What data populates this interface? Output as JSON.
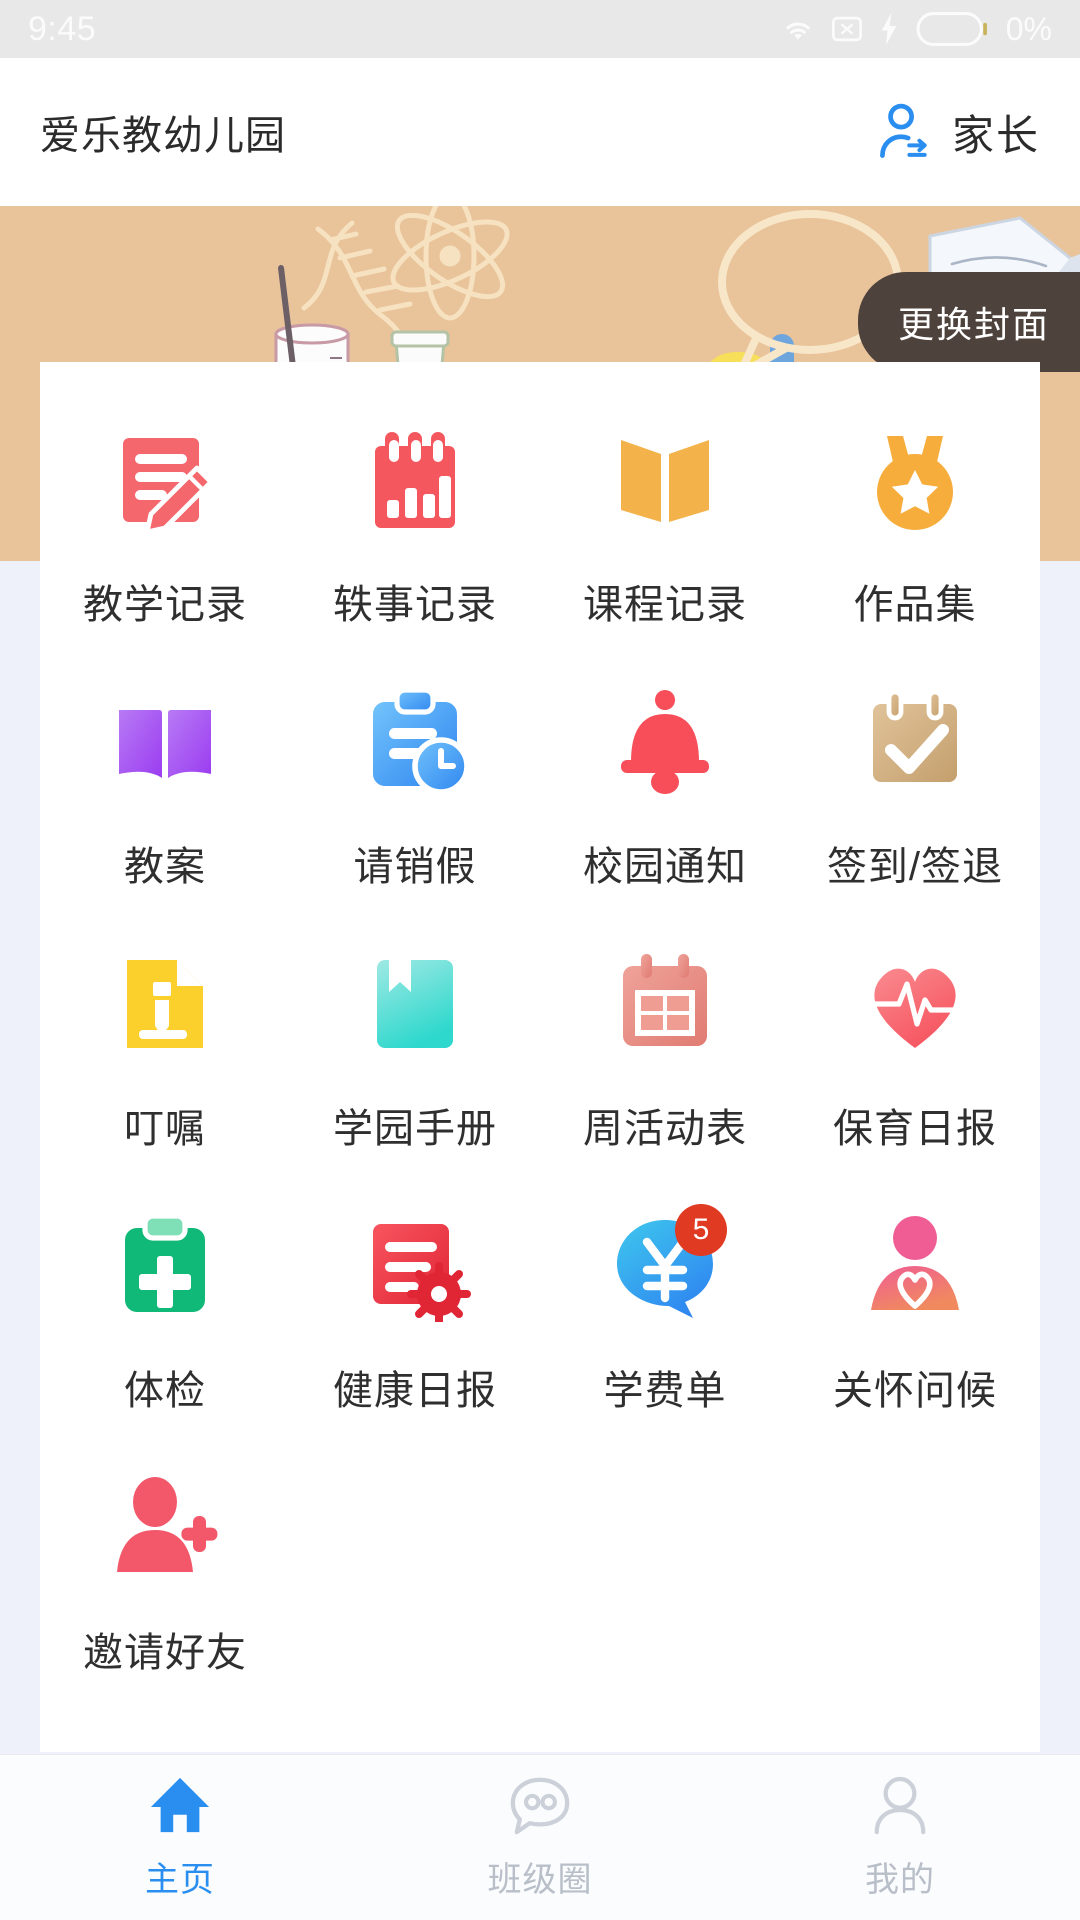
{
  "status_bar": {
    "time": "9:45",
    "battery_percent": "0%",
    "icons": [
      "wifi-icon",
      "sim-no-signal-icon",
      "charging-bolt-icon",
      "battery-icon"
    ]
  },
  "header": {
    "app_title": "爱乐教幼儿园",
    "role_label": "家长",
    "role_icon": "user-switch-icon"
  },
  "banner": {
    "change_cover_label": "更换封面",
    "background_color": "#e9c39a"
  },
  "grid": {
    "tiles": [
      {
        "label": "教学记录",
        "icon": "document-pencil-icon",
        "color": "#f4676c",
        "badge": null
      },
      {
        "label": "轶事记录",
        "icon": "notepad-barchart-icon",
        "color": "#f4575e",
        "badge": null
      },
      {
        "label": "课程记录",
        "icon": "open-book-icon",
        "color": "#f3b24a",
        "badge": null
      },
      {
        "label": "作品集",
        "icon": "medal-star-icon",
        "color": "#f6ad3c",
        "badge": null
      },
      {
        "label": "教案",
        "icon": "purple-open-book-icon",
        "color": "#a95bf0",
        "badge": null
      },
      {
        "label": "请销假",
        "icon": "clipboard-clock-icon",
        "color": "#4aa9f5",
        "badge": null
      },
      {
        "label": "校园通知",
        "icon": "bell-icon",
        "color": "#f74e59",
        "badge": null
      },
      {
        "label": "签到/签退",
        "icon": "calendar-check-icon",
        "color": "#d3ab78",
        "badge": null
      },
      {
        "label": "叮嘱",
        "icon": "document-note-icon",
        "color": "#fbd02c",
        "badge": null
      },
      {
        "label": "学园手册",
        "icon": "bookmark-handbook-icon",
        "color": "#46dcd2",
        "badge": null
      },
      {
        "label": "周活动表",
        "icon": "calendar-grid-icon",
        "color": "#e99089",
        "badge": null
      },
      {
        "label": "保育日报",
        "icon": "heart-pulse-icon",
        "color": "#f86a72",
        "badge": null
      },
      {
        "label": "体检",
        "icon": "medical-clipboard-icon",
        "color": "#11b978",
        "badge": null
      },
      {
        "label": "健康日报",
        "icon": "document-gear-icon",
        "color": "#ed3b46",
        "badge": null
      },
      {
        "label": "学费单",
        "icon": "yuan-bubble-icon",
        "color": "#2ab6ea",
        "badge": "5"
      },
      {
        "label": "关怀问候",
        "icon": "person-heart-icon",
        "color": "#ef6d8c",
        "badge": null
      },
      {
        "label": "邀请好友",
        "icon": "person-add-icon",
        "color": "#f25869",
        "badge": null
      }
    ]
  },
  "bottom_nav": {
    "items": [
      {
        "label": "主页",
        "icon": "home-icon",
        "active": true
      },
      {
        "label": "班级圈",
        "icon": "chat-bubble-icon",
        "active": false
      },
      {
        "label": "我的",
        "icon": "person-outline-icon",
        "active": false
      }
    ],
    "active_color": "#2a8ef0",
    "inactive_color": "#b9bfc9"
  }
}
